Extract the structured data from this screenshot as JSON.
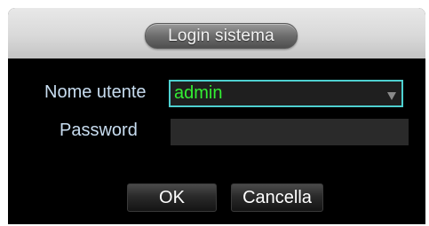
{
  "dialog": {
    "title": "Login sistema",
    "username_label": "Nome utente",
    "username_value": "admin",
    "password_label": "Password",
    "password_value": "",
    "ok_label": "OK",
    "cancel_label": "Cancella"
  },
  "colors": {
    "background": "#000000",
    "label_text": "#c8ddf0",
    "username_text": "#33ee33",
    "focus_border": "#4ed0d0",
    "field_background": "#2a2a2a"
  },
  "icons": {
    "dropdown": "chevron-down-icon"
  }
}
